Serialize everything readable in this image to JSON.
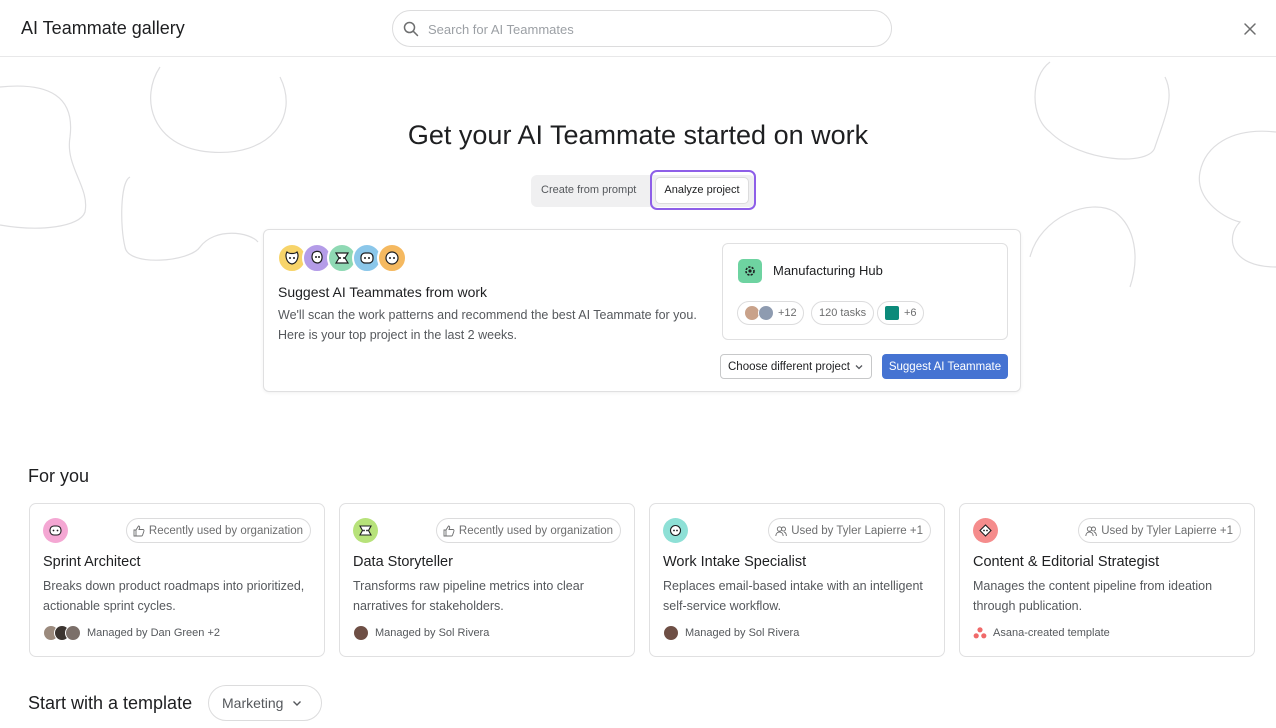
{
  "header": {
    "title": "AI Teammate gallery",
    "search_placeholder": "Search for AI Teammates"
  },
  "hero": {
    "title": "Get your AI Teammate started on work",
    "tabs": [
      "Create from prompt",
      "Analyze project"
    ],
    "active_tab": "Analyze project"
  },
  "suggest": {
    "title": "Suggest AI Teammates from work",
    "description": "We'll scan the work patterns and recommend the best AI Teammate for you. Here is your top project in the last 2 weeks.",
    "project": {
      "name": "Manufacturing Hub",
      "members_extra": "+12",
      "tasks": "120 tasks",
      "integrations_extra": "+6"
    },
    "choose_label": "Choose different project",
    "suggest_label": "Suggest AI Teammate"
  },
  "for_you": {
    "title": "For you",
    "cards": [
      {
        "badge": "Recently used by organization",
        "name": "Sprint Architect",
        "description": "Breaks down product roadmaps into prioritized, actionable sprint cycles.",
        "footer": "Managed by Dan Green +2",
        "icon_color": "#f4a7d3"
      },
      {
        "badge": "Recently used by organization",
        "name": "Data Storyteller",
        "description": "Transforms raw pipeline metrics into clear narratives for stakeholders.",
        "footer": "Managed by Sol Rivera",
        "icon_color": "#b7e27a"
      },
      {
        "badge": "Used by Tyler Lapierre +1",
        "name": "Work Intake Specialist",
        "description": "Replaces email-based intake with an intelligent self-service workflow.",
        "footer": "Managed by Sol Rivera",
        "icon_color": "#8ee0d6"
      },
      {
        "badge": "Used by Tyler Lapierre +1",
        "name": "Content & Editorial Strategist",
        "description": "Manages the content pipeline from ideation through publication.",
        "footer": "Asana-created template",
        "icon_color": "#f58c8c"
      }
    ]
  },
  "template": {
    "title": "Start with a template",
    "selected": "Marketing"
  },
  "colors": {
    "accent": "#4573d2",
    "focus_outline": "#8e5fe8",
    "project_icon": "#6ed3a1"
  }
}
